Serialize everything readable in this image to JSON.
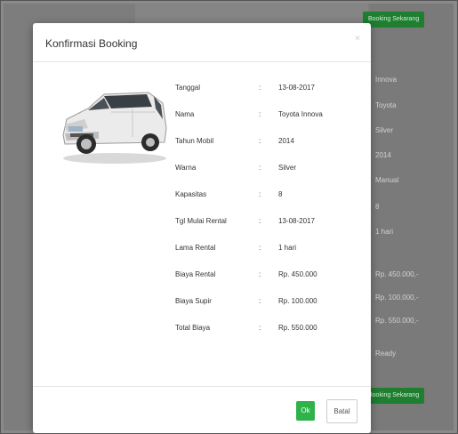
{
  "background": {
    "top_button": "Booking Sekarang",
    "bottom_button": "Booking Sekarang",
    "values": [
      "Innova",
      "Toyota",
      "Silver",
      "2014",
      "Manual",
      "8",
      "1 hari",
      "Rp. 450.000,-",
      "Rp. 100.000,-",
      "Rp. 550.000,-",
      "Ready"
    ]
  },
  "modal": {
    "title": "Konfirmasi Booking",
    "close": "×",
    "car_image": "white-toyota-innova-car",
    "separator": ":",
    "details": [
      {
        "label": "Tanggal",
        "value": "13-08-2017"
      },
      {
        "label": "Nama",
        "value": "Toyota Innova"
      },
      {
        "label": "Tahun Mobil",
        "value": "2014"
      },
      {
        "label": "Warna",
        "value": "Silver"
      },
      {
        "label": "Kapasitas",
        "value": "8"
      },
      {
        "label": "Tgl Mulai Rental",
        "value": "13-08-2017"
      },
      {
        "label": "Lama Rental",
        "value": "1 hari"
      },
      {
        "label": "Biaya Rental",
        "value": "Rp. 450.000"
      },
      {
        "label": "Biaya Supir",
        "value": "Rp. 100.000"
      },
      {
        "label": "Total Biaya",
        "value": "Rp. 550.000"
      }
    ],
    "ok_label": "Ok",
    "cancel_label": "Batal"
  },
  "colors": {
    "ok_button": "#2db34a",
    "background_button": "#1d7f2f",
    "overlay": "#808080"
  }
}
